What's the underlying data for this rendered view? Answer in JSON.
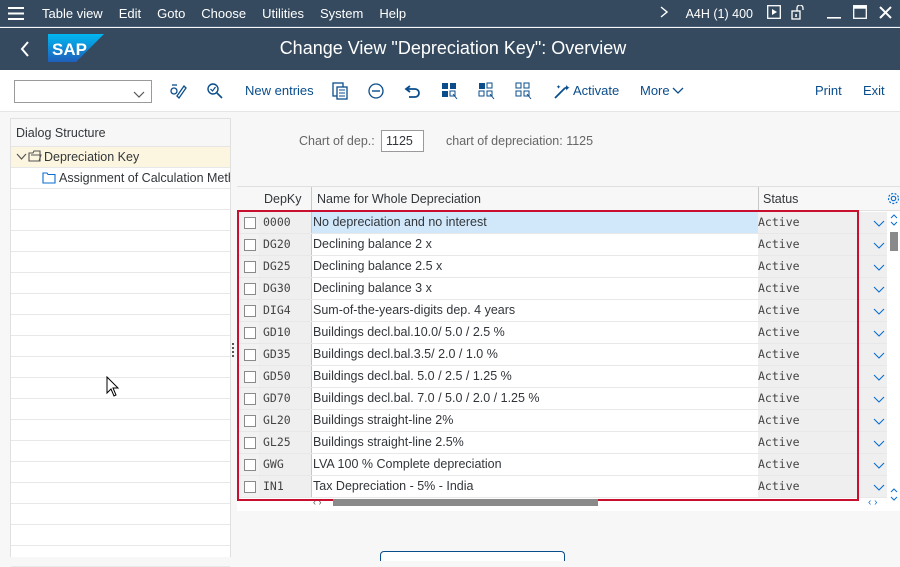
{
  "menubar": {
    "items": [
      "Table view",
      "Edit",
      "Goto",
      "Choose",
      "Utilities",
      "System",
      "Help"
    ],
    "system_info": "A4H (1) 400"
  },
  "titlebar": {
    "title": "Change View \"Depreciation Key\": Overview",
    "logo_text": "SAP"
  },
  "toolbar": {
    "combo_value": "",
    "new_entries": "New entries",
    "activate": "Activate",
    "more": "More",
    "print": "Print",
    "exit": "Exit"
  },
  "dialog_structure": {
    "header": "Dialog Structure",
    "items": [
      {
        "label": "Depreciation Key",
        "selected": true,
        "expanded": true
      },
      {
        "label": "Assignment of Calculation Methods",
        "selected": false
      }
    ]
  },
  "header_fields": {
    "chart_label": "Chart of dep.:",
    "chart_value": "1125",
    "chart_desc": "chart of depreciation: 1125"
  },
  "table": {
    "columns": [
      "DepKy",
      "Name for Whole Depreciation",
      "Status"
    ],
    "rows": [
      {
        "key": "0000",
        "name": "No depreciation and no interest",
        "status": "Active"
      },
      {
        "key": "DG20",
        "name": "Declining balance 2 x",
        "status": "Active"
      },
      {
        "key": "DG25",
        "name": "Declining balance 2.5 x",
        "status": "Active"
      },
      {
        "key": "DG30",
        "name": "Declining balance 3 x",
        "status": "Active"
      },
      {
        "key": "DIG4",
        "name": "Sum-of-the-years-digits dep. 4 years",
        "status": "Active"
      },
      {
        "key": "GD10",
        "name": "Buildings decl.bal.10.0/ 5.0 / 2.5 %",
        "status": "Active"
      },
      {
        "key": "GD35",
        "name": "Buildings decl.bal.3.5/ 2.0 / 1.0  %",
        "status": "Active"
      },
      {
        "key": "GD50",
        "name": "Buildings decl.bal. 5.0 / 2.5 / 1.25 %",
        "status": "Active"
      },
      {
        "key": "GD70",
        "name": "Buildings decl.bal. 7.0 / 5.0 / 2.0 / 1.25 %",
        "status": "Active"
      },
      {
        "key": "GL20",
        "name": "Buildings straight-line 2%",
        "status": "Active"
      },
      {
        "key": "GL25",
        "name": "Buildings straight-line 2.5%",
        "status": "Active"
      },
      {
        "key": "GWG",
        "name": "LVA 100 % Complete depreciation",
        "status": "Active"
      },
      {
        "key": "IN1",
        "name": "Tax Depreciation - 5% - India",
        "status": "Active"
      }
    ]
  },
  "colors": {
    "shell": "#354a5f",
    "accent": "#0a4d8c",
    "highlight_box": "#c8102e",
    "selected_row": "#d1e8fb"
  }
}
